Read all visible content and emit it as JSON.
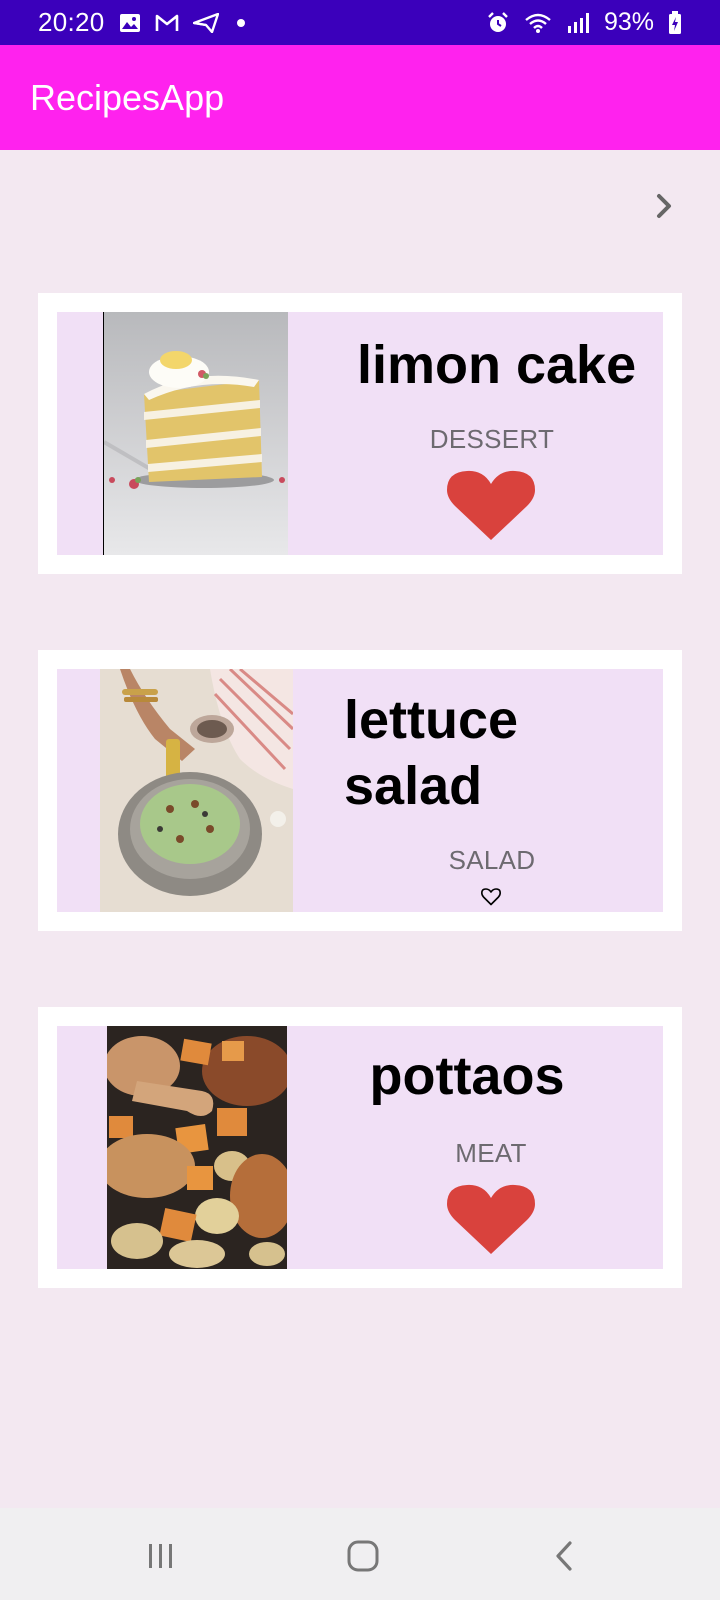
{
  "status_bar": {
    "time": "20:20",
    "battery": "93%",
    "icons_left": [
      "gallery-icon",
      "gmail-icon",
      "send-icon",
      "dot-icon"
    ],
    "icons_right": [
      "alarm-icon",
      "wifi-icon",
      "signal-icon",
      "battery-charging-icon"
    ]
  },
  "app_bar": {
    "title": "RecipesApp"
  },
  "nav": {
    "next_icon": "chevron-right-icon"
  },
  "recipes": [
    {
      "title": "limon cake",
      "category": "DESSERT",
      "favorite": true,
      "image": "cake-photo"
    },
    {
      "title": "lettuce salad",
      "category": "SALAD",
      "favorite": false,
      "image": "salad-photo"
    },
    {
      "title": "pottaos",
      "category": "MEAT",
      "favorite": true,
      "image": "roast-chicken-potatoes-photo"
    }
  ],
  "colors": {
    "status_bar": "#3b00bb",
    "app_bar": "#ff22ee",
    "background": "#f3e8f1",
    "card_inner": "#f1e0f6",
    "heart": "#d9423d"
  },
  "system_nav": {
    "buttons": [
      "recents-icon",
      "home-icon",
      "back-icon"
    ]
  }
}
